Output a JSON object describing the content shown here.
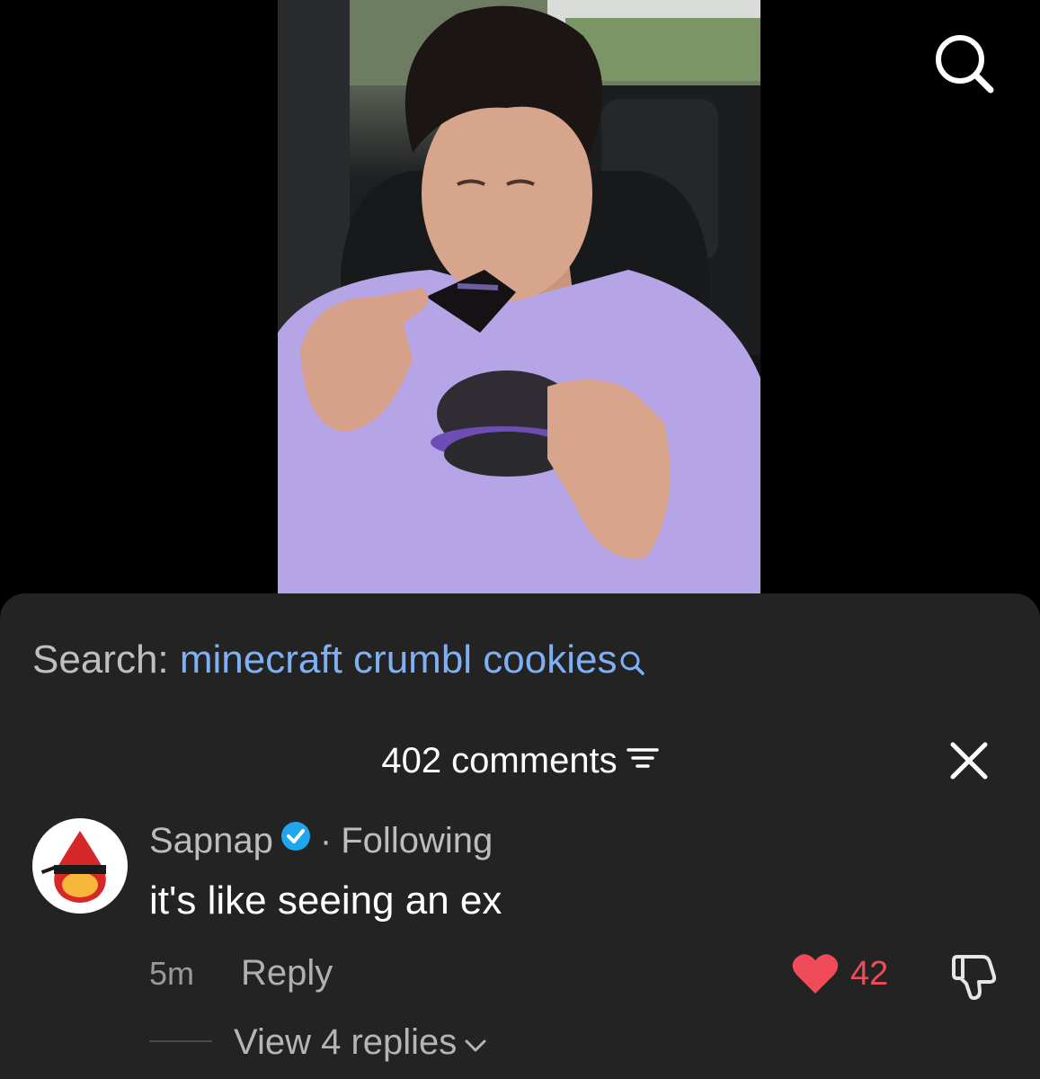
{
  "search": {
    "prefix": "Search: ",
    "query": "minecraft crumbl cookies"
  },
  "comments": {
    "count_label": "402 comments"
  },
  "comment": {
    "username": "Sapnap",
    "separator": "·",
    "status": "Following",
    "text": "it's like seeing an ex",
    "time": "5m",
    "reply_label": "Reply",
    "like_count": "42",
    "view_replies_label": "View 4 replies"
  },
  "colors": {
    "sheet_bg": "#232323",
    "link_blue": "#7fb0f4",
    "like_red": "#f04b59",
    "verified_blue": "#20a5ef"
  },
  "icons": {
    "top_right": "search-icon",
    "search_link": "search-small-icon",
    "sort": "filter-icon",
    "close": "close-icon",
    "like": "heart-icon",
    "dislike": "thumbs-down-icon",
    "expand": "chevron-down-icon"
  }
}
